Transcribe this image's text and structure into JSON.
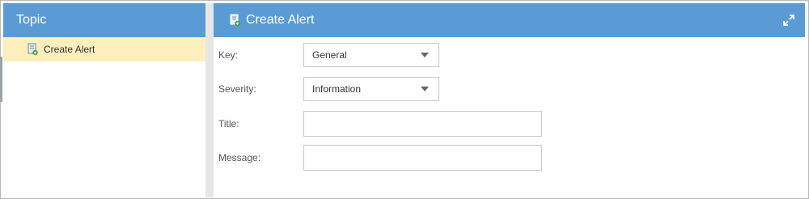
{
  "topic_panel": {
    "title": "Topic",
    "items": [
      {
        "label": "Create Alert",
        "selected": true
      }
    ]
  },
  "form": {
    "title": "Create Alert",
    "fields": {
      "key": {
        "label": "Key:",
        "value": "General"
      },
      "severity": {
        "label": "Severity:",
        "value": "Information"
      },
      "title": {
        "label": "Title:",
        "value": ""
      },
      "message": {
        "label": "Message:",
        "value": ""
      }
    }
  },
  "colors": {
    "header_bg": "#5b9bd5",
    "selected_item_bg": "#fdefbc",
    "divider": "#e6e6e6"
  },
  "icons": {
    "create_alert": "create-alert-icon",
    "expand": "expand-icon"
  }
}
